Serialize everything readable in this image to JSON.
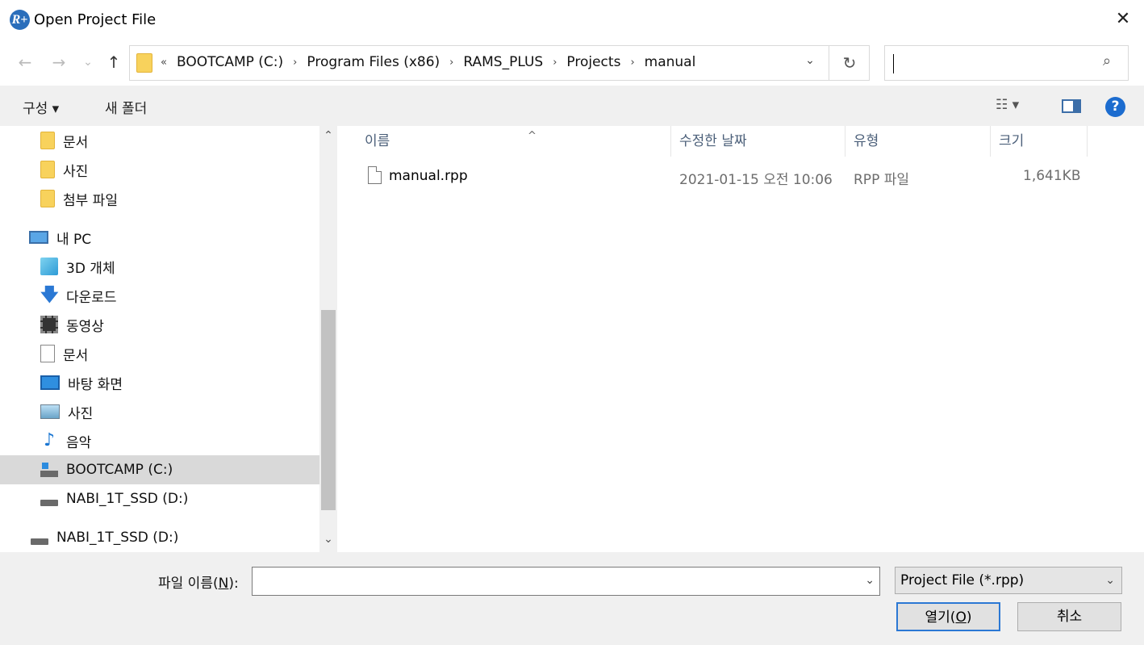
{
  "window": {
    "title": "Open Project File",
    "app_icon": "R+",
    "close": "✕"
  },
  "nav": {
    "back_icon": "←",
    "forward_icon": "→",
    "recent_icon": "⌄",
    "up_icon": "↑",
    "breadcrumb_overflow": "«",
    "breadcrumbs": [
      "BOOTCAMP (C:)",
      "Program Files (x86)",
      "RAMS_PLUS",
      "Projects",
      "manual"
    ],
    "refresh_icon": "↻",
    "search_value": ""
  },
  "toolbar": {
    "organize": "구성 ▾",
    "new_folder": "새 폴더",
    "help": "?"
  },
  "sidebar": {
    "items": [
      {
        "label": "문서",
        "icon": "folder-icon"
      },
      {
        "label": "사진",
        "icon": "folder-icon"
      },
      {
        "label": "첨부 파일",
        "icon": "folder-icon"
      },
      {
        "label": "내 PC",
        "icon": "pc-icon"
      },
      {
        "label": "3D 개체",
        "icon": "3d-objects-icon"
      },
      {
        "label": "다운로드",
        "icon": "download-icon"
      },
      {
        "label": "동영상",
        "icon": "video-icon"
      },
      {
        "label": "문서",
        "icon": "document-icon"
      },
      {
        "label": "바탕 화면",
        "icon": "desktop-icon"
      },
      {
        "label": "사진",
        "icon": "pictures-icon"
      },
      {
        "label": "음악",
        "icon": "music-icon"
      },
      {
        "label": "BOOTCAMP (C:)",
        "icon": "system-drive-icon",
        "selected": true
      },
      {
        "label": "NABI_1T_SSD (D:)",
        "icon": "drive-icon"
      },
      {
        "label": "NABI_1T_SSD (D:)",
        "icon": "drive-icon"
      }
    ]
  },
  "file_list": {
    "columns": [
      "이름",
      "수정한 날짜",
      "유형",
      "크기"
    ],
    "rows": [
      {
        "name": "manual.rpp",
        "modified": "2021-01-15 오전 10:06",
        "type": "RPP 파일",
        "size": "1,641KB"
      }
    ]
  },
  "footer": {
    "filename_label_prefix": "파일 이름(",
    "filename_label_key": "N",
    "filename_label_suffix": "):",
    "filename_value": "",
    "filter_value": "Project File (*.rpp)",
    "open_prefix": "열기(",
    "open_key": "O",
    "open_suffix": ")",
    "cancel": "취소"
  }
}
